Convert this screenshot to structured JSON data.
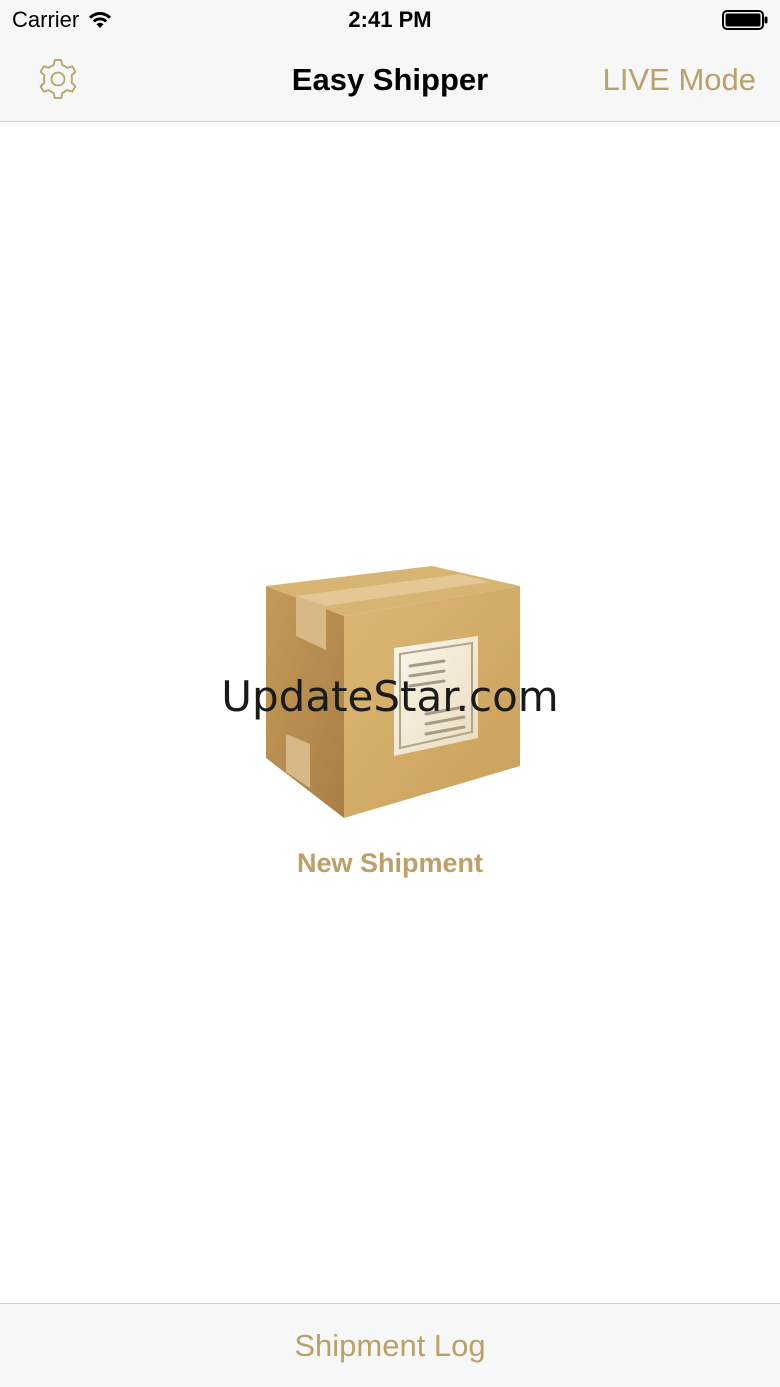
{
  "status_bar": {
    "carrier": "Carrier",
    "time": "2:41 PM",
    "wifi_icon": "wifi-icon",
    "battery_icon": "battery-icon"
  },
  "nav_bar": {
    "title": "Easy Shipper",
    "settings_icon": "gear-icon",
    "mode_label": "LIVE Mode"
  },
  "main": {
    "illustration_icon": "package-box-icon",
    "new_shipment_label": "New Shipment"
  },
  "watermark": {
    "text": "UpdateStar.com"
  },
  "bottom_bar": {
    "shipment_log_label": "Shipment Log"
  },
  "colors": {
    "accent": "#bba067",
    "bar_background": "#f7f7f7",
    "title_text": "#000000"
  }
}
